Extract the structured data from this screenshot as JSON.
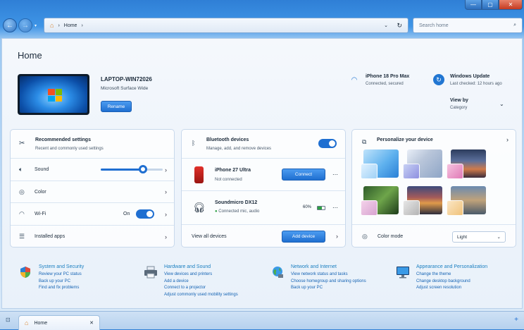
{
  "window": {
    "minimize": "—",
    "maximize": "▢",
    "close": "✕"
  },
  "nav": {
    "back": "←",
    "forward": "→",
    "breadcrumb": [
      "Home"
    ],
    "separator": "›",
    "dropdown": "⌄",
    "refresh": "↻"
  },
  "search": {
    "placeholder": "Search home",
    "icon": "search-icon"
  },
  "page_title": "Home",
  "device": {
    "name": "LAPTOP-WIN72026",
    "model": "Microsoft Surface Wide",
    "rename_label": "Rename"
  },
  "phone_status": {
    "name": "iPhone 18 Pro Max",
    "status": "Connected, secured"
  },
  "windows_update": {
    "title": "Windows Update",
    "last_checked": "Last checked: 12 hours ago"
  },
  "view_by": {
    "label": "View by",
    "value": "Category"
  },
  "recommended": {
    "title": "Recommended settings",
    "subtitle": "Recent and commonly used settings",
    "sound_label": "Sound",
    "sound_level": 0.68,
    "color_label": "Color",
    "wifi_label": "Wi-Fi",
    "wifi_state": "On",
    "apps_label": "Installed apps"
  },
  "bluetooth": {
    "title": "Bluetooth devices",
    "subtitle": "Manage, add, and remove devices",
    "enabled": true,
    "devices": [
      {
        "name": "iPhone 27 Ultra",
        "status": "Not connected",
        "action": "Connect"
      },
      {
        "name": "Soundmicro DX12",
        "status": "Connected mic, audio",
        "battery": "60%"
      }
    ],
    "view_all": "View all devices",
    "add_device": "Add device"
  },
  "personalize": {
    "title": "Personalize your device",
    "color_mode_label": "Color mode",
    "color_mode_value": "Light"
  },
  "categories": [
    {
      "title": "System and Security",
      "links": [
        "Review your PC status",
        "Back up your PC",
        "Find and fix problems"
      ]
    },
    {
      "title": "Hardware and Sound",
      "links": [
        "View devices and printers",
        "Add a device",
        "Connect to a projector",
        "Adjust commonly used mobility settings"
      ]
    },
    {
      "title": "Network and Internet",
      "links": [
        "View network status and tasks",
        "Choose homegroup and sharing options",
        "Back up your PC"
      ]
    },
    {
      "title": "Appearance and Personalization",
      "links": [
        "Change the theme",
        "Change desktop background",
        "Adjust screen resolution"
      ]
    }
  ],
  "taskbar": {
    "tab_label": "Home",
    "tab_close": "✕",
    "new_tab": "+"
  },
  "colors": {
    "accent": "#1f6fd1",
    "link": "#1463b3",
    "category_title": "#1a7fc0"
  }
}
